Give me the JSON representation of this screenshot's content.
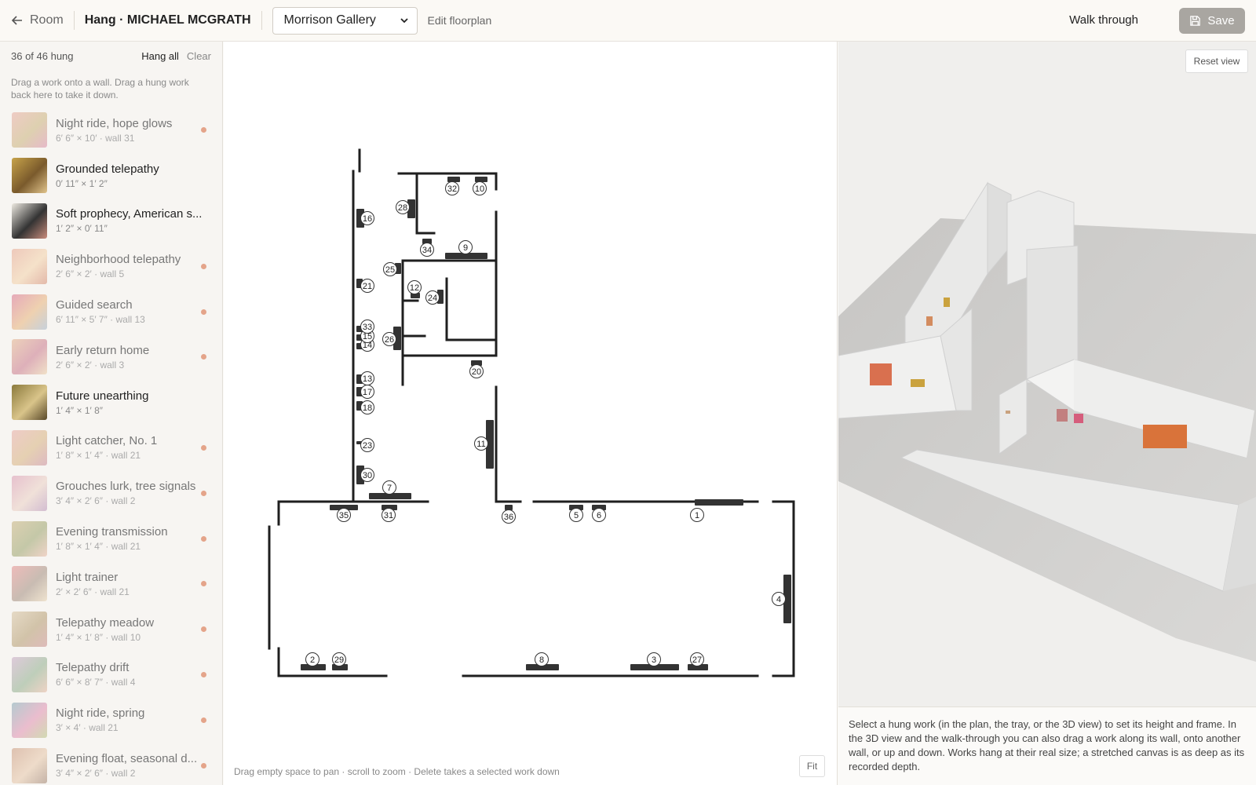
{
  "header": {
    "back_label": "Room",
    "title": "Hang · MICHAEL MCGRATH",
    "gallery_selected": "Morrison Gallery",
    "edit_floorplan": "Edit floorplan",
    "walk_through": "Walk through",
    "save": "Save"
  },
  "tray": {
    "count": "36 of 46 hung",
    "hang_all": "Hang all",
    "clear": "Clear",
    "help": "Drag a work onto a wall. Drag a hung work back here to take it down.",
    "items": [
      {
        "name": "Night ride, hope glows",
        "meta": "6′ 6″ × 10′ · wall 31",
        "hung": true,
        "colors": [
          "#e8a9a0",
          "#c9b27a",
          "#d98aa8"
        ]
      },
      {
        "name": "Grounded telepathy",
        "meta": "0′ 11″ × 1′ 2″",
        "hung": false,
        "colors": [
          "#c7a34a",
          "#7a5a2c",
          "#e1c48c"
        ]
      },
      {
        "name": "Soft prophecy, American s...",
        "meta": "1′ 2″ × 0′ 11″",
        "hung": false,
        "colors": [
          "#eeeae2",
          "#333333",
          "#c98c7c"
        ]
      },
      {
        "name": "Neighborhood telepathy",
        "meta": "2′ 6″ × 2′ · wall 5",
        "hung": true,
        "colors": [
          "#e6a48e",
          "#f3d1a8",
          "#d3886f"
        ]
      },
      {
        "name": "Guided search",
        "meta": "6′ 11″ × 5′ 7″ · wall 13",
        "hung": true,
        "colors": [
          "#d86c8b",
          "#e7b37a",
          "#9fb3c9"
        ]
      },
      {
        "name": "Early return home",
        "meta": "2′ 6″ × 2′ · wall 3",
        "hung": true,
        "colors": [
          "#e3b38c",
          "#c9778b",
          "#ebd0a6"
        ]
      },
      {
        "name": "Future unearthing",
        "meta": "1′ 4″ × 1′ 8″",
        "hung": false,
        "colors": [
          "#8b7a3c",
          "#d9c48a",
          "#5a4a2a"
        ]
      },
      {
        "name": "Light catcher, No. 1",
        "meta": "1′ 8″ × 1′ 4″ · wall 21",
        "hung": true,
        "colors": [
          "#e7a9a4",
          "#d7b27e",
          "#c8899a"
        ]
      },
      {
        "name": "Grouches lurk, tree signals",
        "meta": "3′ 4″ × 2′ 6″ · wall 2",
        "hung": true,
        "colors": [
          "#d996b0",
          "#ead0c4",
          "#b58fb6"
        ]
      },
      {
        "name": "Evening transmission",
        "meta": "1′ 8″ × 1′ 4″ · wall 21",
        "hung": true,
        "colors": [
          "#c6b17c",
          "#9aa36b",
          "#e9b8a5"
        ]
      },
      {
        "name": "Light trainer",
        "meta": "2′ × 2′ 6″ · wall 21",
        "hung": true,
        "colors": [
          "#e58c8c",
          "#a28d7e",
          "#e8d4b2"
        ]
      },
      {
        "name": "Telepathy meadow",
        "meta": "1′ 4″ × 1′ 8″ · wall 10",
        "hung": true,
        "colors": [
          "#d7c3a1",
          "#b39a6d",
          "#c98c8c"
        ]
      },
      {
        "name": "Telepathy drift",
        "meta": "6′ 6″ × 8′ 7″ · wall 4",
        "hung": true,
        "colors": [
          "#c9a7c6",
          "#8fae8c",
          "#e6b7a0"
        ]
      },
      {
        "name": "Night ride, spring",
        "meta": "3′ × 4′ · wall 21",
        "hung": true,
        "colors": [
          "#7fa7b3",
          "#e08fb0",
          "#b3c47e"
        ]
      },
      {
        "name": "Evening float, seasonal d...",
        "meta": "3′ 4″ × 2′ 6″ · wall 2",
        "hung": true,
        "colors": [
          "#c9967a",
          "#e6c6a8",
          "#9c7e6a"
        ]
      }
    ]
  },
  "plan": {
    "hint": "Drag empty space to pan · scroll to zoom · Delete takes a selected work down",
    "fit": "Fit",
    "markers": [
      "1",
      "2",
      "3",
      "4",
      "5",
      "6",
      "7",
      "8",
      "9",
      "10",
      "11",
      "12",
      "13",
      "14",
      "15",
      "16",
      "17",
      "18",
      "20",
      "21",
      "23",
      "24",
      "25",
      "26",
      "27",
      "28",
      "29",
      "30",
      "31",
      "32",
      "33",
      "34",
      "35",
      "36"
    ]
  },
  "view3d": {
    "reset": "Reset view",
    "hint": "Select a hung work (in the plan, the tray, or the 3D view) to set its height and frame. In the 3D view and the walk-through you can also drag a work along its wall, onto another wall, or up and down. Works hang at their real size; a stretched canvas is as deep as its recorded depth."
  }
}
